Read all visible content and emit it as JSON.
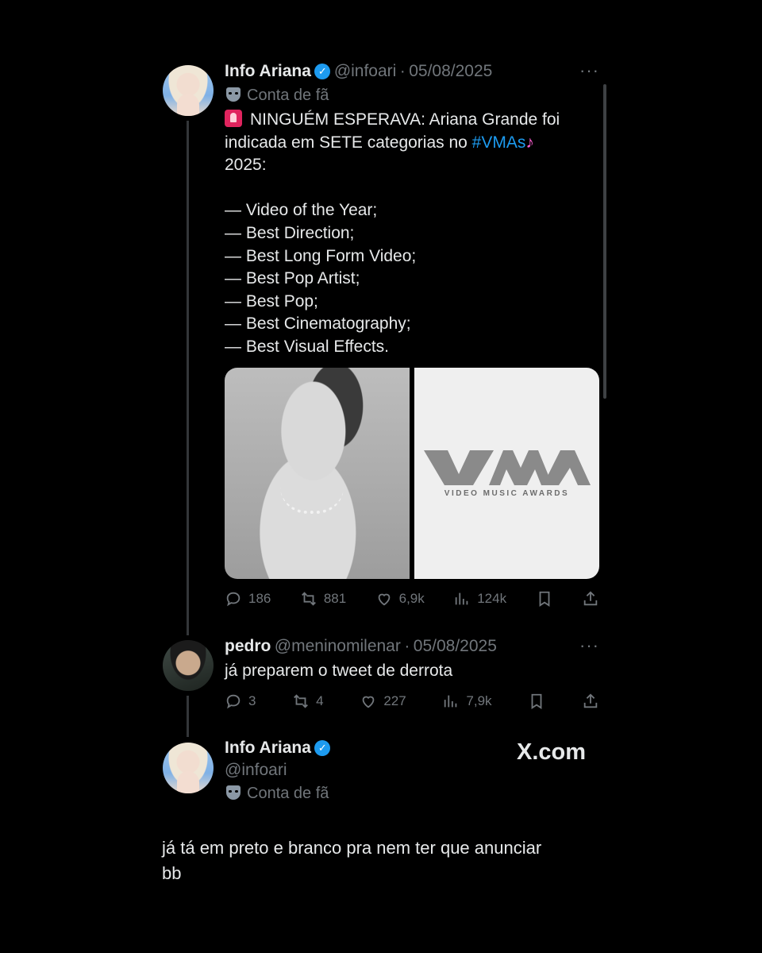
{
  "tweet1": {
    "name": "Info Ariana",
    "handle": "@infoari",
    "dot": "·",
    "date": "05/08/2025",
    "label": "Conta de fã",
    "line1": "NINGUÉM ESPERAVA: Ariana Grande foi",
    "line2_prefix": "indicada em SETE categorias no ",
    "hashtag": "#VMAs",
    "line3": "2025:",
    "categories": [
      "— Video of the Year;",
      "— Best Direction;",
      "— Best Long Form Video;",
      "— Best Pop Artist;",
      "— Best Pop;",
      "— Best Cinematography;",
      "— Best Visual Effects."
    ],
    "media_right_caption": "VIDEO MUSIC AWARDS",
    "stats": {
      "replies": "186",
      "retweets": "881",
      "likes": "6,9k",
      "views": "124k"
    }
  },
  "tweet2": {
    "name": "pedro",
    "handle": "@meninomilenar",
    "dot": "·",
    "date": "05/08/2025",
    "text": "já preparem o tweet de derrota",
    "stats": {
      "replies": "3",
      "retweets": "4",
      "likes": "227",
      "views": "7,9k"
    }
  },
  "tweet3": {
    "name": "Info Ariana",
    "handle": "@infoari",
    "label": "Conta de fã",
    "brand": "X.com",
    "text_line1": "já tá em preto e branco pra nem ter que anunciar",
    "text_line2": "bb"
  },
  "colors": {
    "background": "#000000",
    "accent": "#1d9bf0",
    "muted": "#71767b"
  },
  "icons": [
    "verified-badge-icon",
    "fan-account-mask-icon",
    "siren-emoji-icon",
    "singer-emoji-icon",
    "more-icon",
    "reply-icon",
    "retweet-icon",
    "like-icon",
    "views-icon",
    "bookmark-icon",
    "share-icon"
  ]
}
